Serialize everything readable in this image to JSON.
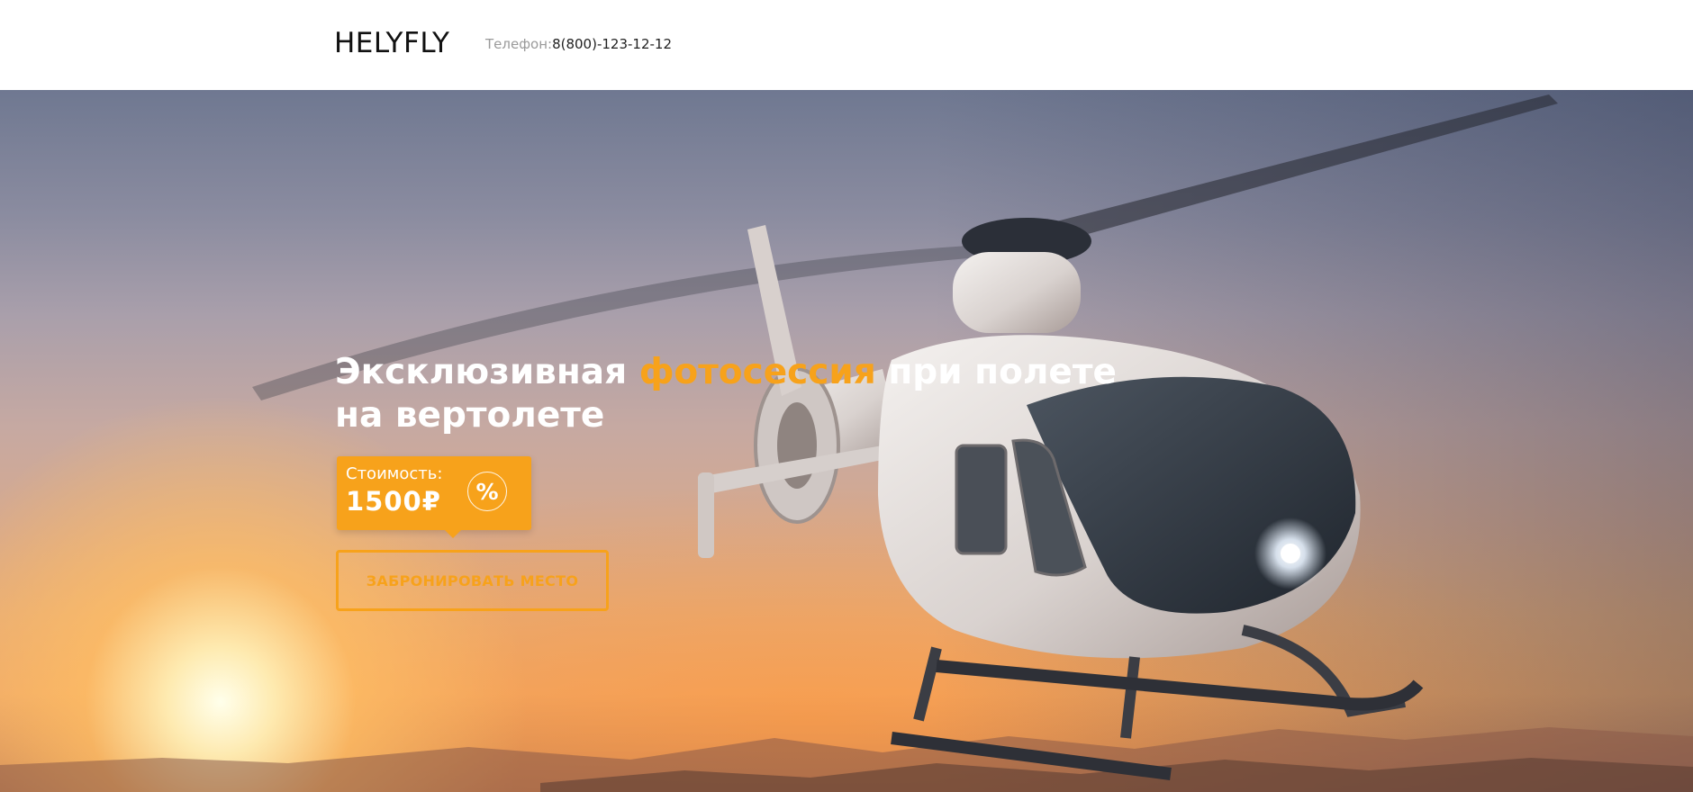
{
  "header": {
    "logo": "HELYFLY",
    "phone_label": "Телефон:",
    "phone_number": "8(800)-123-12-12"
  },
  "hero": {
    "headline_part1": "Эксклюзивная ",
    "headline_accent": "фотосессия",
    "headline_part2": " при полете на вертолете",
    "price_label": "Стоимость:",
    "price_value": "1500₽",
    "discount_symbol": "%",
    "cta_label": "ЗАБРОНИРОВАТЬ МЕСТО"
  },
  "colors": {
    "accent": "#f7a21b",
    "header_bg": "#ffffff",
    "text_dark": "#111111",
    "text_muted": "#9a9a9a"
  },
  "icons": [
    "percent-icon"
  ],
  "images": [
    "helicopter-sunset-photo"
  ]
}
